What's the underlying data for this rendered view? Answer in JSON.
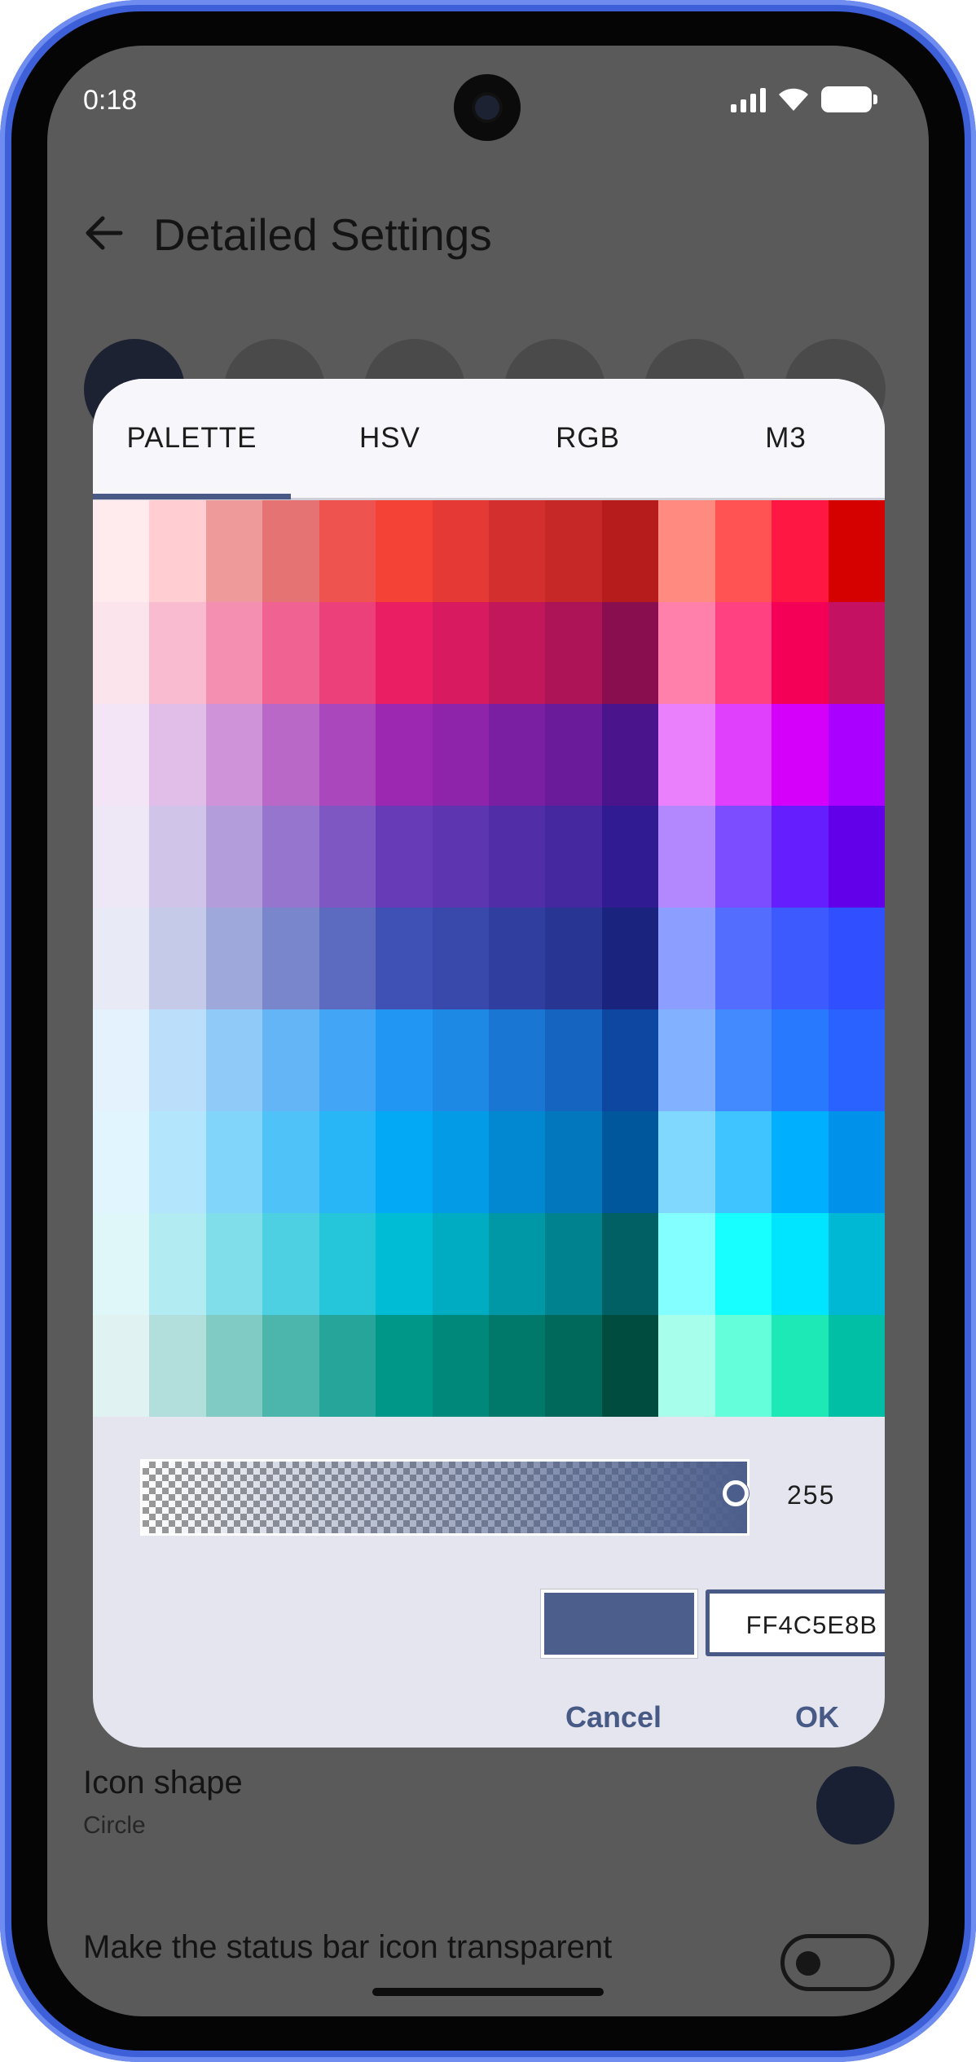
{
  "status_bar": {
    "time": "0:18"
  },
  "app_bar": {
    "title": "Detailed Settings",
    "back_icon": "arrow-back-icon"
  },
  "background_settings": {
    "icon_shape_title": "Icon shape",
    "icon_shape_value": "Circle",
    "status_bar_transparent_label": "Make the status bar icon transparent"
  },
  "dialog": {
    "tabs": [
      {
        "label": "PALETTE",
        "selected": true
      },
      {
        "label": "HSV",
        "selected": false
      },
      {
        "label": "RGB",
        "selected": false
      },
      {
        "label": "M3",
        "selected": false
      }
    ],
    "palette_rows": [
      [
        "#FFEBEE",
        "#FFCDD2",
        "#EF9A9A",
        "#E57373",
        "#EF5350",
        "#F44336",
        "#E53935",
        "#D32F2F",
        "#C62828",
        "#B71C1C",
        "#FF8A80",
        "#FF5252",
        "#FF1744",
        "#D50000"
      ],
      [
        "#FCE4EC",
        "#F8BBD0",
        "#F48FB1",
        "#F06292",
        "#EC407A",
        "#E91E63",
        "#D81B60",
        "#C2185B",
        "#AD1457",
        "#880E4F",
        "#FF80AB",
        "#FF4081",
        "#F50057",
        "#C51162"
      ],
      [
        "#F3E5F5",
        "#E1BEE7",
        "#CE93D8",
        "#BA68C8",
        "#AB47BC",
        "#9C27B0",
        "#8E24AA",
        "#7B1FA2",
        "#6A1B9A",
        "#4A148C",
        "#EA80FC",
        "#E040FB",
        "#D500F9",
        "#AA00FF"
      ],
      [
        "#EDE7F6",
        "#D1C4E9",
        "#B39DDB",
        "#9575CD",
        "#7E57C2",
        "#673AB7",
        "#5E35B1",
        "#512DA8",
        "#4527A0",
        "#311B92",
        "#B388FF",
        "#7C4DFF",
        "#651FFF",
        "#6200EA"
      ],
      [
        "#E8EAF6",
        "#C5CAE9",
        "#9FA8DA",
        "#7986CB",
        "#5C6BC0",
        "#3F51B5",
        "#3949AB",
        "#303F9F",
        "#283593",
        "#1A237E",
        "#8C9EFF",
        "#536DFE",
        "#3D5AFE",
        "#304FFE"
      ],
      [
        "#E3F2FD",
        "#BBDEFB",
        "#90CAF9",
        "#64B5F6",
        "#42A5F5",
        "#2196F3",
        "#1E88E5",
        "#1976D2",
        "#1565C0",
        "#0D47A1",
        "#82B1FF",
        "#448AFF",
        "#2979FF",
        "#2962FF"
      ],
      [
        "#E1F5FE",
        "#B3E5FC",
        "#81D4FA",
        "#4FC3F7",
        "#29B6F6",
        "#03A9F4",
        "#039BE5",
        "#0288D1",
        "#0277BD",
        "#01579B",
        "#80D8FF",
        "#40C4FF",
        "#00B0FF",
        "#0091EA"
      ],
      [
        "#E0F7FA",
        "#B2EBF2",
        "#80DEEA",
        "#4DD0E1",
        "#26C6DA",
        "#00BCD4",
        "#00ACC1",
        "#0097A7",
        "#00838F",
        "#006064",
        "#84FFFF",
        "#18FFFF",
        "#00E5FF",
        "#00B8D4"
      ],
      [
        "#E0F2F1",
        "#B2DFDB",
        "#80CBC4",
        "#4DB6AC",
        "#26A69A",
        "#009688",
        "#00897B",
        "#00796B",
        "#00695C",
        "#004D40",
        "#A7FFEB",
        "#64FFDA",
        "#1DE9B6",
        "#00BFA5"
      ]
    ],
    "alpha_value": "255",
    "alpha_fraction": 1.0,
    "selected_color": "#4C5E8B",
    "hex_value": "FF4C5E8B",
    "cancel_label": "Cancel",
    "ok_label": "OK"
  },
  "colors": {
    "accent": "#4A5A86",
    "scrim_background": "#5A5A5A",
    "dialog_background": "#E4E5EF"
  }
}
